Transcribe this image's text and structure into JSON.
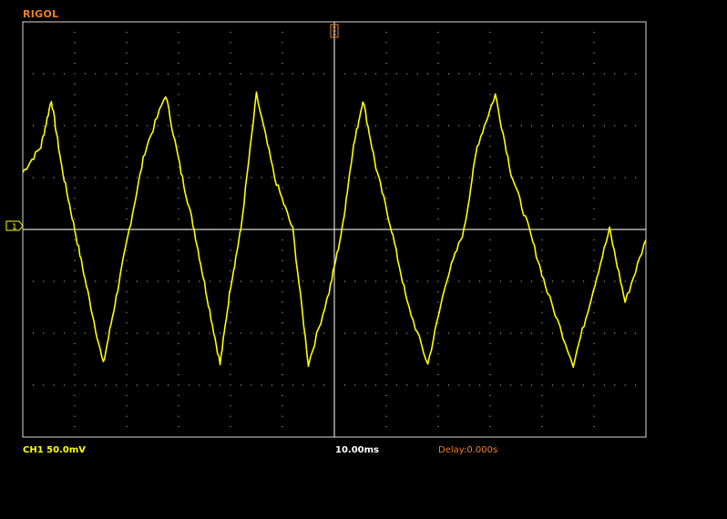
{
  "brand": "RIGOL",
  "colors": {
    "background": "#000000",
    "grid": "#d8d8d8",
    "channel1": "#ffff00",
    "trigger_marker": "#f08020",
    "timebase_text": "#ffffff",
    "delay_text": "#f08020"
  },
  "markers": {
    "channel1_ground": "1",
    "trigger_icon": "trigger-position-icon"
  },
  "status": {
    "channel1_scale": "CH1 50.0mV",
    "timebase": "10.00ms",
    "delay": "Delay:0.000s"
  },
  "chart_data": {
    "type": "line",
    "grid": true,
    "grid_divisions": {
      "horizontal": 12,
      "vertical": 8
    },
    "series": [
      {
        "x_div": [
          0,
          0.35,
          0.55,
          0.75,
          1.0,
          1.25,
          1.55,
          1.8,
          2.05,
          2.35,
          2.75,
          3.05,
          3.3,
          3.55,
          3.8,
          4.0,
          4.2,
          4.5,
          4.85,
          5.2,
          5.5,
          5.9,
          6.15,
          6.35,
          6.55,
          6.8,
          7.1,
          7.4,
          7.8,
          8.15,
          8.5,
          8.75,
          9.1,
          9.4,
          9.75,
          10.1,
          10.6,
          10.95,
          11.3,
          11.6,
          12.0
        ],
        "y_div": [
          1.1,
          1.6,
          2.5,
          1.2,
          0.0,
          -1.2,
          -2.6,
          -1.3,
          0.0,
          1.5,
          2.6,
          1.1,
          0.0,
          -1.3,
          -2.6,
          -1.1,
          0.0,
          2.6,
          1.0,
          0.0,
          -2.6,
          -1.2,
          0.0,
          1.5,
          2.5,
          1.2,
          0.0,
          -1.4,
          -2.6,
          -1.0,
          0.0,
          1.6,
          2.6,
          1.1,
          0.0,
          -1.2,
          -2.6,
          -1.3,
          0.0,
          -1.4,
          -0.2
        ]
      }
    ]
  }
}
